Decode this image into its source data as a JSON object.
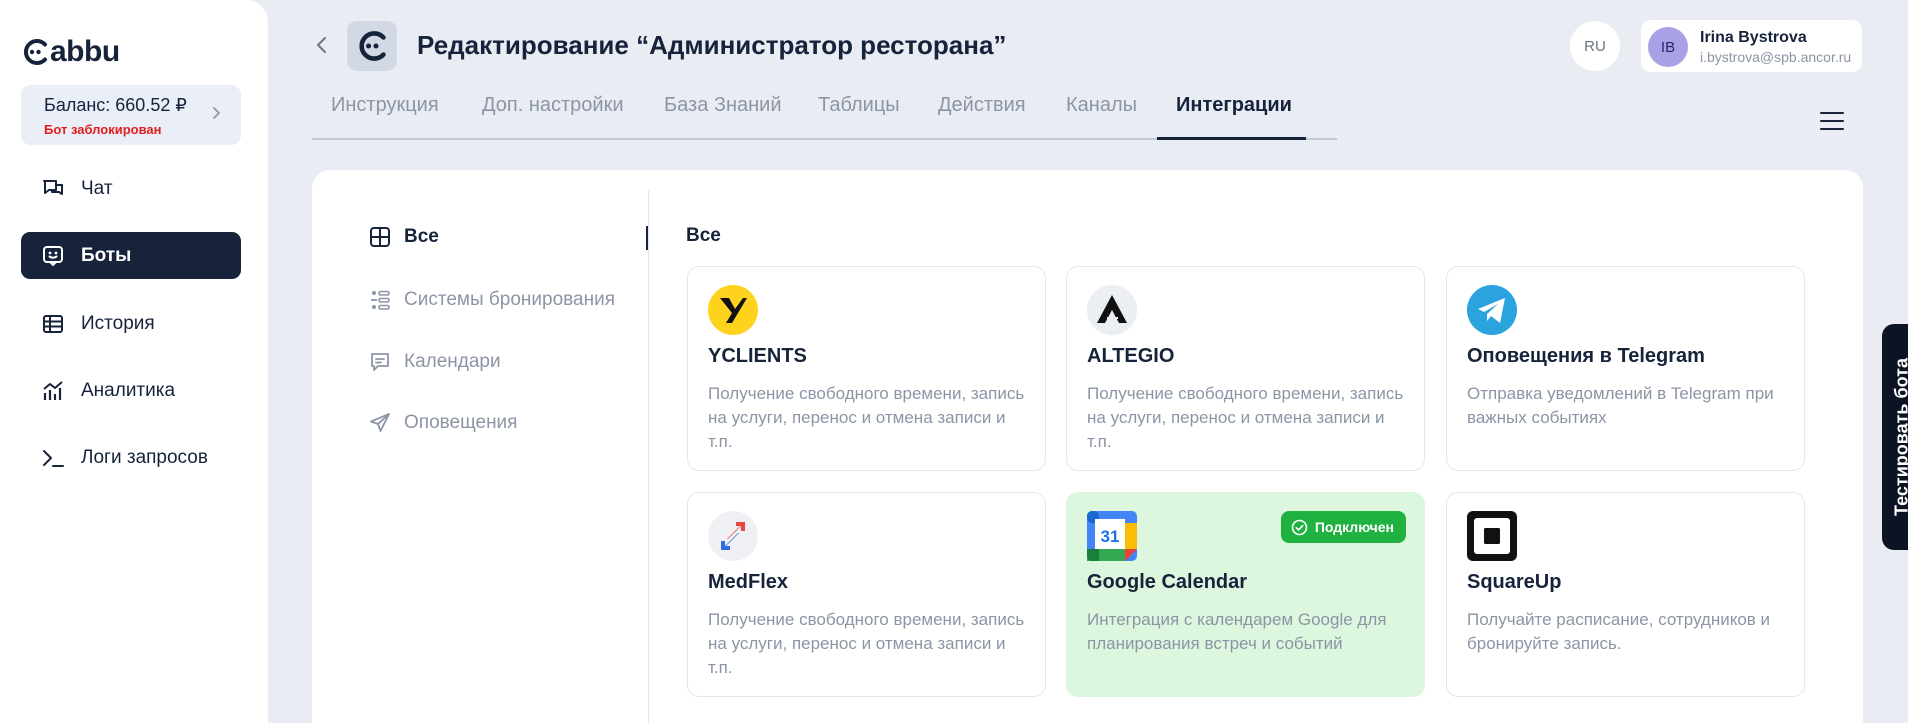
{
  "brand": {
    "logo_text": "abbu"
  },
  "sidebar": {
    "balance_label": "Баланс: 660.52 ₽",
    "balance_status": "Бот заблокирован",
    "items": [
      {
        "label": "Чат",
        "icon": "chat-icon"
      },
      {
        "label": "Боты",
        "icon": "bot-icon",
        "active": true
      },
      {
        "label": "История",
        "icon": "history-icon"
      },
      {
        "label": "Аналитика",
        "icon": "analytics-icon"
      },
      {
        "label": "Логи запросов",
        "icon": "terminal-icon"
      }
    ]
  },
  "header": {
    "title": "Редактирование “Администратор ресторана”",
    "language": "RU",
    "user": {
      "initials": "IB",
      "name": "Irina Bystrova",
      "email": "i.bystrova@spb.ancor.ru"
    }
  },
  "tabs": [
    {
      "label": "Инструкция"
    },
    {
      "label": "Доп. настройки"
    },
    {
      "label": "База Знаний"
    },
    {
      "label": "Таблицы"
    },
    {
      "label": "Действия"
    },
    {
      "label": "Каналы"
    },
    {
      "label": "Интеграции",
      "active": true
    }
  ],
  "categories": [
    {
      "label": "Все",
      "icon": "grid-icon",
      "active": true
    },
    {
      "label": "Системы бронирования",
      "icon": "booking-icon"
    },
    {
      "label": "Календари",
      "icon": "calendar-icon"
    },
    {
      "label": "Оповещения",
      "icon": "send-icon"
    }
  ],
  "section_title": "Все",
  "integrations": [
    {
      "title": "YCLIENTS",
      "description": "Получение свободного времени, запись на услуги, перенос и отмена записи и т.п.",
      "icon": "yclients-logo"
    },
    {
      "title": "ALTEGIO",
      "description": "Получение свободного времени, запись на услуги, перенос и отмена записи и т.п.",
      "icon": "altegio-logo"
    },
    {
      "title": "Оповещения в Telegram",
      "description": "Отправка уведомлений в Telegram при важных событиях",
      "icon": "telegram-logo"
    },
    {
      "title": "MedFlex",
      "description": "Получение свободного времени, запись на услуги, перенос и отмена записи и т.п.",
      "icon": "medflex-logo"
    },
    {
      "title": "Google Calendar",
      "description": "Интеграция с календарем Google для планирования встреч и событий",
      "icon": "google-calendar-logo",
      "connected": true,
      "badge": "Подключен",
      "calendar_day": "31"
    },
    {
      "title": "SquareUp",
      "description": "Получайте расписание, сотрудников и бронируйте запись.",
      "icon": "squareup-logo"
    }
  ],
  "test_bot_label": "Тестировать бота",
  "colors": {
    "accent": "#16233b",
    "connected_bg": "#dcf7de",
    "badge": "#1fb240",
    "warning": "#e11d1d"
  }
}
